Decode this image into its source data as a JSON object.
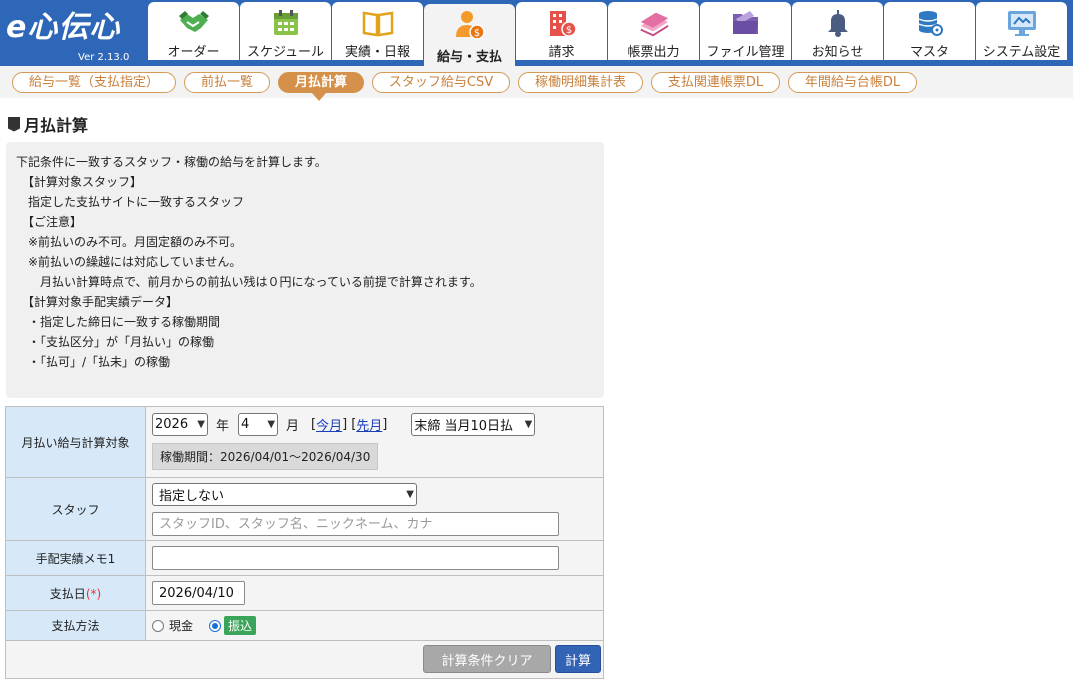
{
  "app": {
    "logo_text": "e心伝心",
    "version": "Ver 2.13.0"
  },
  "colors": {
    "header": "#2f67b8",
    "pill": "#d5914a",
    "label_cell": "#d7e9f9",
    "calc_button": "#3363b4",
    "transfer_badge": "#3aa55a"
  },
  "nav": {
    "tabs": [
      {
        "label": "オーダー",
        "icon": "handshake-icon"
      },
      {
        "label": "スケジュール",
        "icon": "calendar-icon"
      },
      {
        "label": "実績・日報",
        "icon": "book-icon"
      },
      {
        "label": "給与・支払",
        "icon": "person-coin-icon",
        "active": true
      },
      {
        "label": "請求",
        "icon": "building-coin-icon"
      },
      {
        "label": "帳票出力",
        "icon": "documents-icon"
      },
      {
        "label": "ファイル管理",
        "icon": "folder-icon"
      },
      {
        "label": "お知らせ",
        "icon": "bell-icon"
      },
      {
        "label": "マスタ",
        "icon": "database-gear-icon"
      },
      {
        "label": "システム設定",
        "icon": "monitor-settings-icon"
      }
    ]
  },
  "subnav": {
    "items": [
      {
        "label": "給与一覧（支払指定）"
      },
      {
        "label": "前払一覧"
      },
      {
        "label": "月払計算",
        "active": true
      },
      {
        "label": "スタッフ給与CSV"
      },
      {
        "label": "稼働明細集計表"
      },
      {
        "label": "支払関連帳票DL"
      },
      {
        "label": "年間給与台帳DL"
      }
    ]
  },
  "page": {
    "title": "月払計算"
  },
  "notes": {
    "lines": [
      "下記条件に一致するスタッフ・稼働の給与を計算します。",
      "　【計算対象スタッフ】",
      "　指定した支払サイトに一致するスタッフ",
      "　【ご注意】",
      "　※前払いのみ不可。月固定額のみ不可。",
      "　※前払いの繰越には対応していません。",
      "　　月払い計算時点で、前月からの前払い残は０円になっている前提で計算されます。",
      "",
      "　【計算対象手配実績データ】",
      "　・指定した締日に一致する稼働期間",
      "　・「支払区分」が「月払い」の稼働",
      "　・「払可」/「払未」の稼働"
    ]
  },
  "form": {
    "target": {
      "label": "月払い給与計算対象",
      "year": "2026",
      "year_unit": "年",
      "month": "4",
      "month_unit": "月",
      "this_month": "今月",
      "prev_month": "先月",
      "bracket_open": "[",
      "bracket_close": "]",
      "closing": "末締 当月10日払",
      "period": "稼働期間：2026/04/01～2026/04/30"
    },
    "staff": {
      "label": "スタッフ",
      "select": "指定しない",
      "placeholder": "スタッフID、スタッフ名、ニックネーム、カナ",
      "value": ""
    },
    "memo": {
      "label": "手配実績メモ1",
      "value": ""
    },
    "pay_date": {
      "label": "支払日",
      "required": "(*)",
      "value": "2026/04/10"
    },
    "pay_method": {
      "label": "支払方法",
      "cash": "現金",
      "transfer": "振込",
      "selected": "振込"
    },
    "buttons": {
      "clear": "計算条件クリア",
      "calc": "計算"
    }
  }
}
